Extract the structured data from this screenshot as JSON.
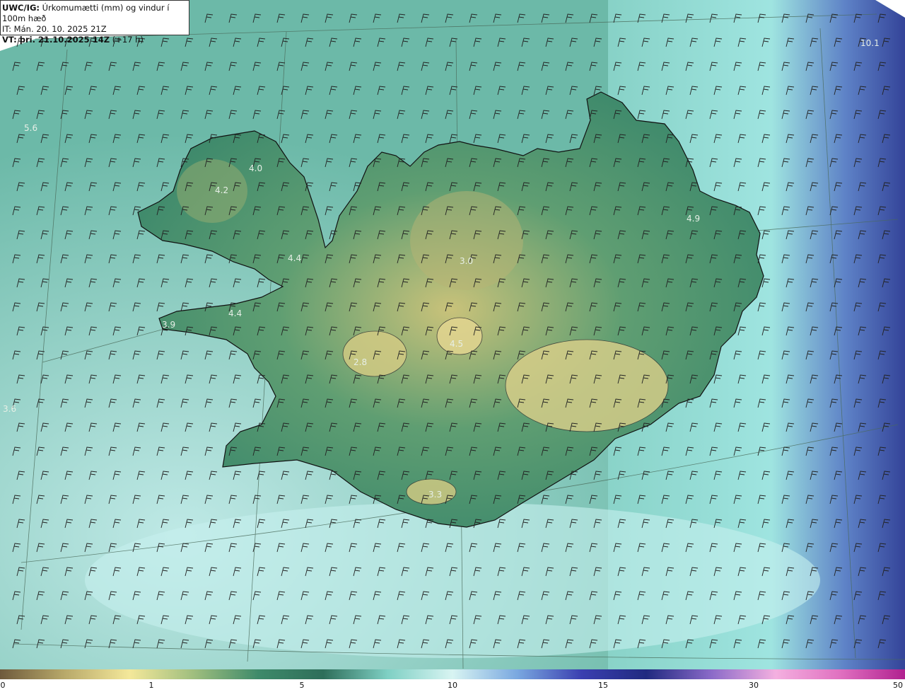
{
  "header": {
    "model": "UWC/IG:",
    "title": "Úrkomumætti (mm) og vindur í 100m hæð",
    "init_time": "IT: Mán. 20. 10. 2025 21Z",
    "valid_prefix": "VT: þri. 21.10.2025 14Z",
    "valid_offset": "(+17 h)"
  },
  "map_labels": [
    {
      "text": "5.6"
    },
    {
      "text": "4.0"
    },
    {
      "text": "4.2"
    },
    {
      "text": "4.4"
    },
    {
      "text": "4.4"
    },
    {
      "text": "3.9"
    },
    {
      "text": "3.0"
    },
    {
      "text": "2.8"
    },
    {
      "text": "4.5"
    },
    {
      "text": "4.9"
    },
    {
      "text": "3.3"
    },
    {
      "text": "10.1"
    },
    {
      "text": "3.6"
    }
  ],
  "colorbar": {
    "ticks": [
      "0",
      "1",
      "5",
      "10",
      "15",
      "30",
      "50"
    ],
    "colors": [
      "#6e5a3c",
      "#b8a96a",
      "#f4e89a",
      "#9fbe7e",
      "#3e8a6a",
      "#2e6e5a",
      "#7fd0c4",
      "#d8f4f2",
      "#7aa8e0",
      "#3a3fb0",
      "#202a80",
      "#8a6ac8",
      "#f4b0e0",
      "#e070c0",
      "#b0208f"
    ]
  },
  "icons": {
    "wind": "wind-barb-icon"
  }
}
